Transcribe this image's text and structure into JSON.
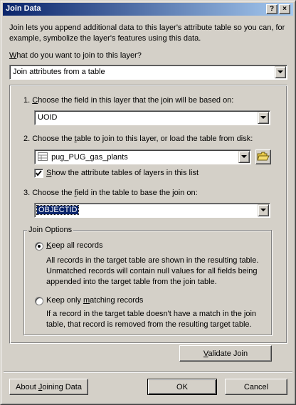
{
  "window": {
    "title": "Join Data"
  },
  "titlebar_buttons": {
    "help": "?",
    "close": "×"
  },
  "intro_text": "Join lets you append additional data to this layer's attribute table so you can, for example, symbolize the layer's features using this data.",
  "join_question": {
    "pre": "",
    "hotkey": "W",
    "post": "hat do you want to join to this layer?"
  },
  "join_type": {
    "value": "Join attributes from a table"
  },
  "step1": {
    "pre": "1.  ",
    "hotkey": "C",
    "post": "hoose the field in this layer that the join will be based on:",
    "value": "UOID"
  },
  "step2": {
    "pre": "2.  Choose the ",
    "hotkey": "t",
    "post": "able to join to this layer, or load the table from disk:",
    "value": "pug_PUG_gas_plants"
  },
  "show_tables": {
    "pre": "",
    "hotkey": "S",
    "post": "how the attribute tables of layers in this list",
    "checked": true
  },
  "step3": {
    "pre": "3.  Choose the ",
    "hotkey": "f",
    "post": "ield in the table to base the join on:",
    "value": "OBJECTID"
  },
  "join_options": {
    "legend": "Join Options",
    "keep_all": {
      "pre": "",
      "hotkey": "K",
      "post": "eep all records",
      "description": "All records in the target table are shown in the resulting table. Unmatched records will contain null values for all fields being appended into the target table from the join table.",
      "selected": true
    },
    "keep_matching": {
      "pre": "Keep only ",
      "hotkey": "m",
      "post": "atching records",
      "description": "If a record in the target table doesn't have a match in the join table, that record is removed from the resulting target table.",
      "selected": false
    }
  },
  "validate_button": {
    "pre": "",
    "hotkey": "V",
    "post": "alidate Join"
  },
  "about_button": {
    "pre": "About ",
    "hotkey": "J",
    "post": "oining Data"
  },
  "ok_button": {
    "label": "OK"
  },
  "cancel_button": {
    "label": "Cancel"
  }
}
